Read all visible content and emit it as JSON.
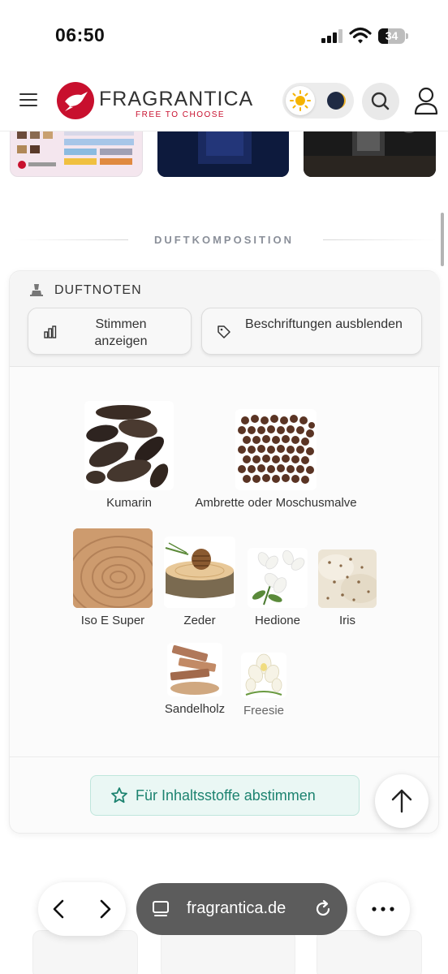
{
  "status_bar": {
    "time": "06:50",
    "battery": "34",
    "icons": [
      "signal-icon",
      "wifi-icon",
      "battery-icon"
    ]
  },
  "header": {
    "logo_text": "FRAGRANTICA",
    "logo_tagline": "FREE TO CHOOSE",
    "icons": [
      "menu-icon",
      "sun-icon",
      "moon-icon",
      "search-icon",
      "user-icon"
    ]
  },
  "section": {
    "title": "DUFTKOMPOSITION"
  },
  "notes_card": {
    "title": "DUFTNOTEN",
    "title_icon": "pyramid-icon",
    "show_votes_label": "Stimmen anzeigen",
    "hide_labels_label": "Beschriftungen ausblenden",
    "notes": [
      {
        "label": "Kumarin",
        "icon": "tonka-bean-image"
      },
      {
        "label": "Ambrette oder Moschusmalve",
        "icon": "ambrette-seeds-image"
      },
      {
        "label": "Iso E Super",
        "icon": "wood-grain-image"
      },
      {
        "label": "Zeder",
        "icon": "cedar-image"
      },
      {
        "label": "Hedione",
        "icon": "jasmine-flower-image"
      },
      {
        "label": "Iris",
        "icon": "iris-image"
      },
      {
        "label": "Sandelholz",
        "icon": "sandalwood-image"
      },
      {
        "label": "Freesie",
        "icon": "freesia-image"
      }
    ],
    "vote_button_label": "Für Inhaltsstoffe abstimmen"
  },
  "browser": {
    "url": "fragrantica.de",
    "icons": [
      "back-icon",
      "forward-icon",
      "tabs-icon",
      "reload-icon",
      "more-icon"
    ]
  },
  "colors": {
    "brand_red": "#c8102e",
    "vote_green": "#1d8370",
    "vote_bg": "#eaf7f4",
    "url_bar": "#5c5c5c"
  }
}
